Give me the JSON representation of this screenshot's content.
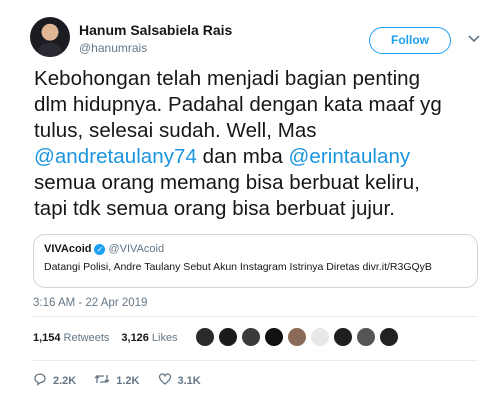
{
  "user": {
    "display_name": "Hanum Salsabiela Rais",
    "handle": "@hanumrais",
    "follow_label": "Follow"
  },
  "tweet": {
    "lines": [
      [
        {
          "text": "Kebohongan telah menjadi bagian penting"
        }
      ],
      [
        {
          "text": "dlm hidupnya. Padahal dengan kata maaf yg"
        }
      ],
      [
        {
          "text": "tulus, selesai sudah. Well,  Mas"
        }
      ],
      [
        {
          "text": "@andretaulany74",
          "mention": true
        },
        {
          "text": " dan mba "
        },
        {
          "text": "@erintaulany",
          "mention": true
        }
      ],
      [
        {
          "text": "semua orang memang bisa berbuat keliru,"
        }
      ],
      [
        {
          "text": "tapi tdk semua orang bisa berbuat jujur."
        }
      ]
    ]
  },
  "quoted_tweet": {
    "name": "VIVAcoid",
    "verified_mark": "✓",
    "handle": "@VIVAcoid",
    "text": "Datangi Polisi, Andre Taulany Sebut Akun Instagram Istrinya Diretas divr.it/R3GQyB"
  },
  "timestamp": "3:16 AM - 22 Apr 2019",
  "stats": {
    "retweets_count": "1,154",
    "retweets_label": "Retweets",
    "likes_count": "3,126",
    "likes_label": "Likes"
  },
  "liker_avatars": [
    "#2b2b2b",
    "#1a1a1a",
    "#3a3a3a",
    "#111111",
    "#8a6b5a",
    "#e8e8e8",
    "#1f1f1f",
    "#555555",
    "#222222"
  ],
  "actions": {
    "reply_count": "2.2K",
    "retweet_count": "1.2K",
    "like_count": "3.1K"
  },
  "icons": {
    "chevron": "chevron-down-icon",
    "reply": "reply-icon",
    "retweet": "retweet-icon",
    "like": "heart-icon",
    "verified": "verified-badge-icon"
  },
  "colors": {
    "accent": "#1da1f2",
    "mention": "#1b95e0",
    "muted": "#657786",
    "border": "#ccd6dd"
  }
}
